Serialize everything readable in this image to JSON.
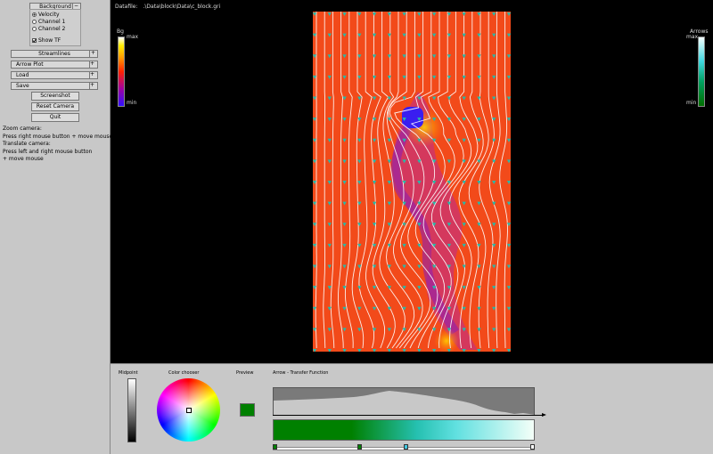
{
  "left_panel": {
    "background_label": "Background",
    "radios": [
      "Velocity",
      "Channel 1",
      "Channel 2"
    ],
    "selected_radio": "Velocity",
    "show_tf_label": "Show TF",
    "show_tf_checked": true,
    "rollouts": [
      {
        "label": "Streamlines",
        "sign": "+"
      },
      {
        "label": "Arrow Plot",
        "sign": "+"
      },
      {
        "label": "Load",
        "sign": "+"
      },
      {
        "label": "Save",
        "sign": "+"
      }
    ],
    "collapse_sign": "−",
    "buttons": [
      "Screenshot",
      "Reset Camera",
      "Quit"
    ],
    "help_lines": [
      "Zoom camera:",
      "Press right mouse button + move mouse",
      "Translate camera:",
      "Press left and right mouse button",
      "+ move mouse"
    ]
  },
  "viewport": {
    "datafile_label": "Datafile:",
    "datafile_path": ".\\Data\\block\\Data\\c_block.gri",
    "bg_legend": {
      "title": "Bg",
      "max": "max",
      "min": "min"
    },
    "arrow_legend": {
      "title": "Arrows",
      "max": "max",
      "min": "min"
    }
  },
  "bottom_panel": {
    "midpoint_label": "Midpoint",
    "color_chooser_label": "Color chooser",
    "preview_label": "Preview",
    "preview_color": "#008000",
    "tf_title": "Arrow - Transfer Function",
    "knob_positions": [
      0.0,
      0.33,
      0.51,
      1.0
    ],
    "knob_colors": [
      "#008000",
      "#008000",
      "#40c8e0",
      "#ffffff"
    ]
  }
}
